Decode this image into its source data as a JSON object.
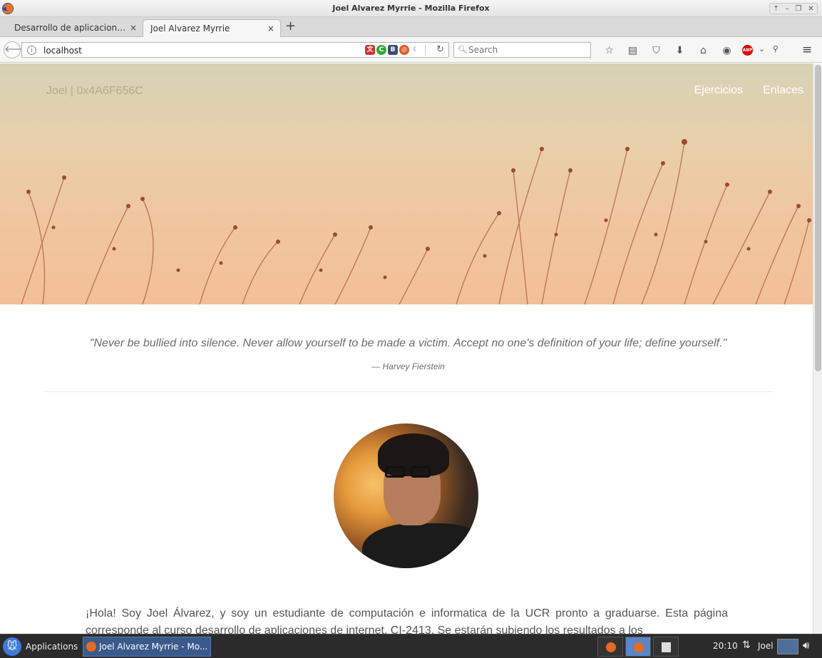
{
  "window": {
    "title": "Joel Alvarez Myrrie - Mozilla Firefox"
  },
  "tabs": [
    {
      "label": "Desarrollo de aplicacion…",
      "close": "×"
    },
    {
      "label": "Joel Alvarez Myrrie",
      "close": "×"
    }
  ],
  "new_tab_label": "+",
  "urlbar": {
    "url": "localhost",
    "info_glyph": "i"
  },
  "search": {
    "placeholder": "Search"
  },
  "site": {
    "brand": "Joel | 0x4A6F656C",
    "nav": [
      "Ejercicios",
      "Enlaces"
    ],
    "quote": "\"Never be bullied into silence. Never allow yourself to be made a victim. Accept no one's definition of your life; define yourself.\"",
    "quote_author": "— Harvey Fierstein",
    "intro": "¡Hola! Soy Joel Álvarez, y soy un estudiante de computación e informatica de la UCR pronto a graduarse. Esta página corresponde al curso desarrollo de aplicaciones de internet, CI-2413. Se estarán subiendo los resultados a los"
  },
  "taskbar": {
    "applications_label": "Applications",
    "task_window": "Joel Alvarez Myrrie - Mo...",
    "clock": "20:10",
    "user": "Joel"
  },
  "colors": {
    "brand_text": "#b7aa8e",
    "nav_text": "#ffffff",
    "quote_text": "#6c6c6c"
  }
}
